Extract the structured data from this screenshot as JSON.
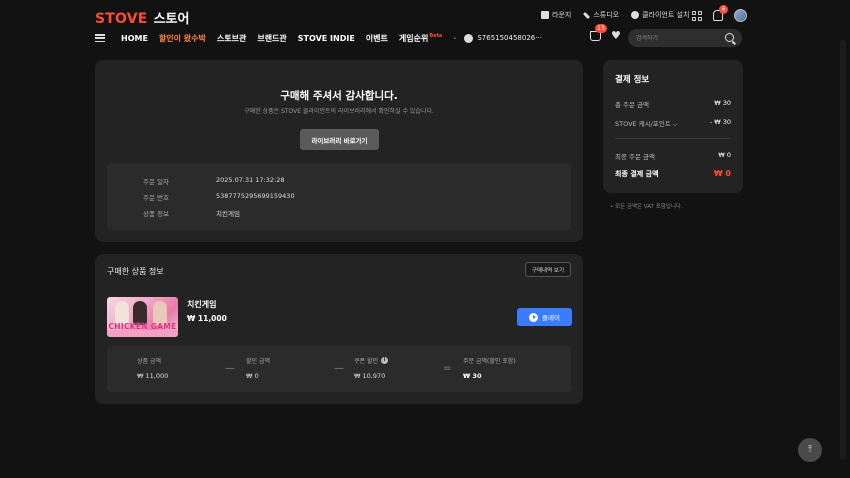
{
  "header": {
    "brand": "STOVE",
    "brand_sub": "스토어",
    "util_links": [
      {
        "label": "라운지",
        "icon": "lounge-icon"
      },
      {
        "label": "스튜디오",
        "icon": "studio-icon"
      },
      {
        "label": "클라이언트 설치",
        "icon": "play-circle-icon"
      }
    ],
    "notification_count": "6",
    "cart_count": "13"
  },
  "nav": {
    "items": [
      "HOME",
      "할인이 왔수박",
      "스토브관",
      "브랜드관",
      "STOVE INDIE",
      "이벤트",
      "게임순위"
    ],
    "beta": "Beta",
    "user_id": "S765150458026···",
    "search_placeholder": "검색하기"
  },
  "thanks": {
    "title": "구매해 주셔서 감사합니다.",
    "desc": "구매한 상품은 STOVE 클라이언트의 라이브러리에서 확인하실 수 있습니다.",
    "library_button": "라이브러리 바로가기",
    "order": [
      {
        "label": "주문 일자",
        "value": "2025.07.31 17:32:28"
      },
      {
        "label": "주문 번호",
        "value": "5387775295699159430"
      },
      {
        "label": "상품 정보",
        "value": "치킨게임"
      }
    ]
  },
  "products": {
    "title": "구매한 상품 정보",
    "history_button": "구매내역 보기",
    "item": {
      "name": "치킨게임",
      "price": "₩ 11,000",
      "thumb_text": "CHICKEN GAME",
      "play_button": "플레이"
    },
    "summary": [
      {
        "label": "상품 금액",
        "value": "₩ 11,000"
      },
      {
        "label": "할인 금액",
        "value": "₩ 0"
      },
      {
        "label": "쿠폰 할인",
        "value": "₩ 10,970"
      },
      {
        "label": "주문 금액(할인 포함)",
        "value": "₩ 30"
      }
    ],
    "ops": [
      "—",
      "—",
      "="
    ]
  },
  "payment": {
    "title": "결제 정보",
    "rows": [
      {
        "label": "총 주문 금액",
        "value": "₩ 30"
      },
      {
        "label": "STOVE 캐시/포인트",
        "value": "- ₩ 30"
      },
      {
        "label": "최종 주문 금액",
        "value": "₩ 0"
      },
      {
        "label": "최종 결제 금액",
        "value": "₩ 0"
      }
    ],
    "vat_note": "• 모든 금액은 VAT 포함입니다."
  },
  "colors": {
    "accent": "#ff4b35",
    "primary_button": "#3b7cff",
    "panel": "#232323",
    "background": "#121212"
  }
}
